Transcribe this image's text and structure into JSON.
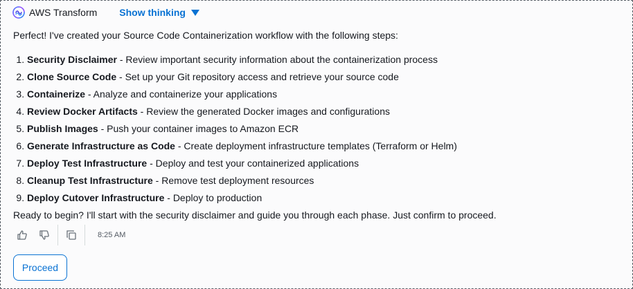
{
  "header": {
    "brand": "AWS Transform",
    "show_thinking": "Show thinking"
  },
  "message": {
    "intro": "Perfect! I've created your Source Code Containerization workflow with the following steps:",
    "steps": [
      {
        "title": "Security Disclaimer",
        "desc": " - Review important security information about the containerization process"
      },
      {
        "title": "Clone Source Code",
        "desc": " - Set up your Git repository access and retrieve your source code"
      },
      {
        "title": "Containerize",
        "desc": " - Analyze and containerize your applications"
      },
      {
        "title": "Review Docker Artifacts",
        "desc": " - Review the generated Docker images and configurations"
      },
      {
        "title": "Publish Images",
        "desc": " - Push your container images to Amazon ECR"
      },
      {
        "title": "Generate Infrastructure as Code",
        "desc": " - Create deployment infrastructure templates (Terraform or Helm)"
      },
      {
        "title": "Deploy Test Infrastructure",
        "desc": " - Deploy and test your containerized applications"
      },
      {
        "title": "Cleanup Test Infrastructure",
        "desc": " - Remove test deployment resources"
      },
      {
        "title": "Deploy Cutover Infrastructure",
        "desc": " - Deploy to production"
      }
    ],
    "outro": "Ready to begin? I'll start with the security disclaimer and guide you through each phase. Just confirm to proceed."
  },
  "actions": {
    "icons": [
      "thumbs-up-icon",
      "thumbs-down-icon",
      "copy-icon"
    ],
    "timestamp": "8:25 AM"
  },
  "proceed_label": "Proceed",
  "colors": {
    "accent": "#0972d3",
    "text": "#16191f",
    "muted": "#687078"
  }
}
